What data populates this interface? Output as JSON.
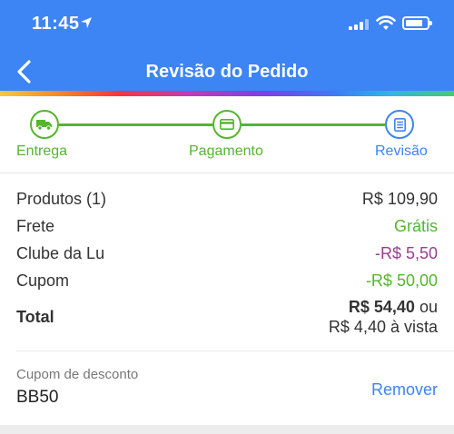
{
  "status_bar": {
    "time": "11:45"
  },
  "header": {
    "title": "Revisão do Pedido"
  },
  "stepper": {
    "steps": [
      {
        "label": "Entrega",
        "icon": "truck-icon"
      },
      {
        "label": "Pagamento",
        "icon": "credit-card-icon"
      },
      {
        "label": "Revisão",
        "icon": "document-icon"
      }
    ],
    "active_step": 2
  },
  "summary": {
    "products_label": "Produtos (1)",
    "products_value": "R$ 109,90",
    "shipping_label": "Frete",
    "shipping_value": "Grátis",
    "club_label": "Clube da Lu",
    "club_value": "-R$ 5,50",
    "coupon_label": "Cupom",
    "coupon_value": "-R$ 50,00",
    "total_label": "Total",
    "total_amount": "R$ 54,40",
    "total_or": "ou",
    "total_cash": "R$ 4,40 à vista"
  },
  "coupon_section": {
    "label": "Cupom de desconto",
    "code": "BB50",
    "remove_label": "Remover"
  },
  "colors": {
    "primary": "#3d84f5",
    "success": "#55b52e",
    "club": "#9a3f8e"
  }
}
